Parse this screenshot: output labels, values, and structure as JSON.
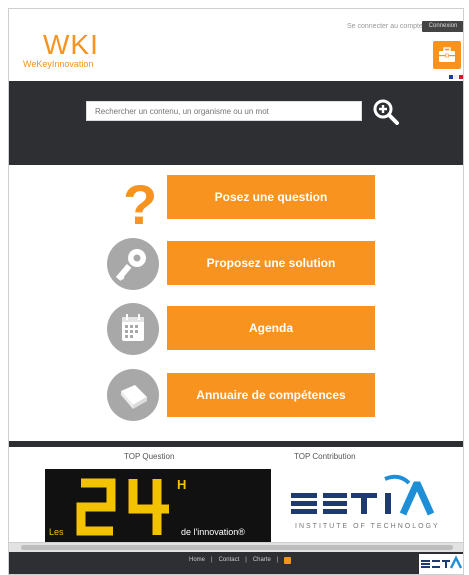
{
  "header": {
    "logo_title": "WKI",
    "logo_subtitle": "WeKeyInnovation",
    "login_link": "Se connecter au compte",
    "login_button": "Connexion",
    "case_icon": "briefcase-icon",
    "flag_colors": [
      "#1a3c9e",
      "#ffffff",
      "#cc1f2b"
    ]
  },
  "search": {
    "placeholder": "Rechercher un contenu, un organisme ou un mot"
  },
  "actions": [
    {
      "label": "Posez une question",
      "icon": "question-icon"
    },
    {
      "label": "Proposez une solution",
      "icon": "key-icon"
    },
    {
      "label": "Agenda",
      "icon": "calendar-icon"
    },
    {
      "label": "Annuaire de compétences",
      "icon": "book-icon"
    }
  ],
  "bottom": {
    "top_question_label": "TOP Question",
    "top_contribution_label": "TOP Contribution",
    "promo_les": "Les",
    "promo_number": "24",
    "promo_h": "H",
    "promo_caption": "de l'innovation®",
    "estia_word": "ESTIA",
    "estia_tagline": "INSTITUTE OF TECHNOLOGY"
  },
  "footer": {
    "links": [
      "Home",
      "Contact",
      "Charte",
      "RSS"
    ],
    "separator": "|",
    "logo": "ESTIA"
  },
  "colors": {
    "accent": "#f7931e",
    "dark_band": "#2e2f32",
    "estia_blue": "#1e8ed6",
    "promo_yellow": "#f4c300"
  }
}
